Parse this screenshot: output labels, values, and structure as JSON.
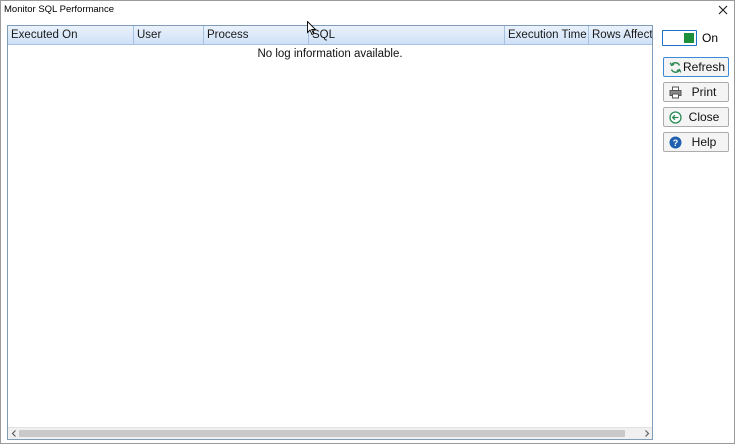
{
  "window": {
    "title": "Monitor SQL Performance",
    "close_glyph": "✕"
  },
  "grid": {
    "columns": [
      "Executed On",
      "User",
      "Process",
      "SQL",
      "Execution Time",
      "Rows Affecte"
    ],
    "empty_message": "No log information available.",
    "rows": []
  },
  "toggle": {
    "label": "On",
    "state": true,
    "color": "#1e8f3a"
  },
  "buttons": [
    {
      "label": "Refresh",
      "icon": "refresh-icon"
    },
    {
      "label": "Print",
      "icon": "printer-icon"
    },
    {
      "label": "Close",
      "icon": "back-arrow-icon"
    },
    {
      "label": "Help",
      "icon": "help-icon"
    }
  ],
  "colors": {
    "header_gradient_top": "#eaf2fc",
    "header_gradient_bottom": "#cfe1f7",
    "accent": "#1d72c7"
  }
}
